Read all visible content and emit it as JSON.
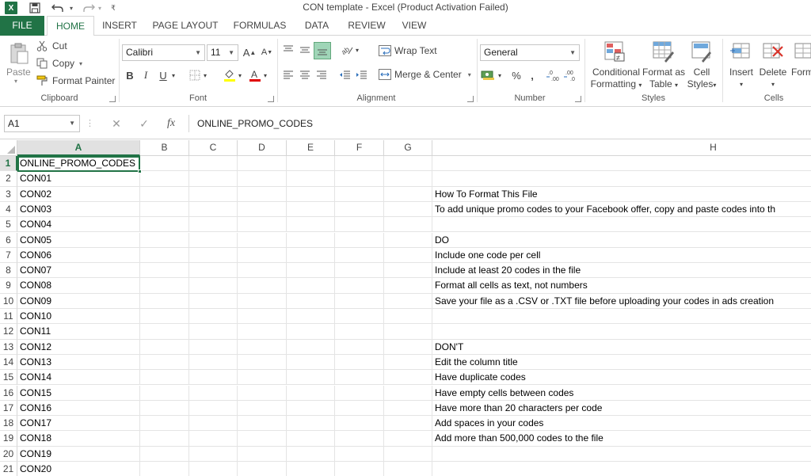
{
  "window": {
    "title": "CON template - Excel (Product Activation Failed)",
    "logo_text": "X"
  },
  "tabs": [
    "FILE",
    "HOME",
    "INSERT",
    "PAGE LAYOUT",
    "FORMULAS",
    "DATA",
    "REVIEW",
    "VIEW"
  ],
  "ribbon": {
    "clipboard": {
      "paste": "Paste",
      "cut": "Cut",
      "copy": "Copy",
      "format_painter": "Format Painter",
      "label": "Clipboard"
    },
    "font": {
      "name": "Calibri",
      "size": "11",
      "grow": "A",
      "shrink": "A",
      "bold": "B",
      "italic": "I",
      "underline": "U",
      "label": "Font"
    },
    "alignment": {
      "wrap_text": "Wrap Text",
      "merge_center": "Merge & Center",
      "label": "Alignment"
    },
    "number": {
      "format": "General",
      "percent": "%",
      "comma": ",",
      "label": "Number"
    },
    "styles": {
      "conditional_line1": "Conditional",
      "conditional_line2": "Formatting",
      "format_table_line1": "Format as",
      "format_table_line2": "Table",
      "cell_styles_line1": "Cell",
      "cell_styles_line2": "Styles",
      "label": "Styles"
    },
    "cells": {
      "insert": "Insert",
      "delete": "Delete",
      "format": "Form",
      "label": "Cells"
    }
  },
  "formula_bar": {
    "name_box": "A1",
    "fx": "fx",
    "content": "ONLINE_PROMO_CODES"
  },
  "columns": [
    "A",
    "B",
    "C",
    "D",
    "E",
    "F",
    "G",
    "H"
  ],
  "rows": [
    "1",
    "2",
    "3",
    "4",
    "5",
    "6",
    "7",
    "8",
    "9",
    "10",
    "11",
    "12",
    "13",
    "14",
    "15",
    "16",
    "17",
    "18",
    "19",
    "20",
    "21"
  ],
  "col_a": [
    "ONLINE_PROMO_CODES",
    "CON01",
    "CON02",
    "CON03",
    "CON04",
    "CON05",
    "CON06",
    "CON07",
    "CON08",
    "CON09",
    "CON10",
    "CON11",
    "CON12",
    "CON13",
    "CON14",
    "CON15",
    "CON16",
    "CON17",
    "CON18",
    "CON19",
    "CON20"
  ],
  "col_h": [
    "",
    "",
    "How To Format This File",
    "To add unique promo codes to your Facebook offer, copy and paste codes into th",
    "",
    "DO",
    "Include one code per cell",
    "Include at least 20 codes in the file",
    "Format all cells as text, not numbers",
    "Save your file as a .CSV or .TXT file before uploading your codes in ads creation",
    "",
    "",
    "DON'T",
    "Edit the column title",
    "Have duplicate codes",
    "Have empty cells between codes",
    "Have more than 20 characters per code",
    "Add spaces in your codes",
    "Add more than 500,000 codes to the file",
    "",
    ""
  ],
  "colors": {
    "accent": "#217346",
    "grid_line": "#e4e4e4",
    "header_border": "#d5d5d5"
  }
}
